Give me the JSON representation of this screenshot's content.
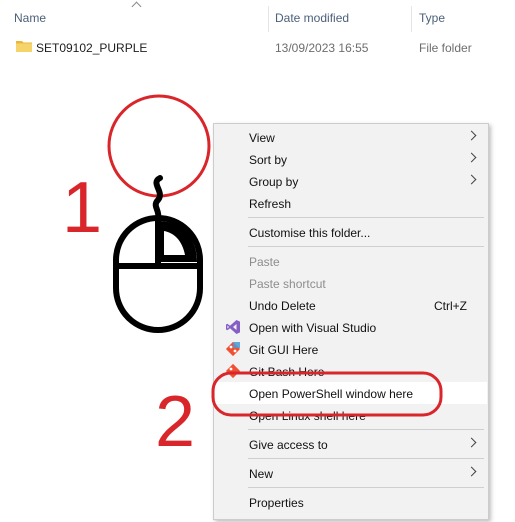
{
  "columns": {
    "name": "Name",
    "date": "Date modified",
    "type": "Type"
  },
  "files": [
    {
      "name": "SET09102_PURPLE",
      "date": "13/09/2023 16:55",
      "type": "File folder"
    }
  ],
  "context_menu": {
    "items": [
      {
        "label": "View",
        "submenu": true
      },
      {
        "label": "Sort by",
        "submenu": true
      },
      {
        "label": "Group by",
        "submenu": true
      },
      {
        "label": "Refresh"
      },
      {
        "label": "Customise this folder..."
      },
      {
        "label": "Paste",
        "disabled": true
      },
      {
        "label": "Paste shortcut",
        "disabled": true
      },
      {
        "label": "Undo Delete",
        "shortcut": "Ctrl+Z"
      },
      {
        "label": "Open with Visual Studio",
        "icon": "visual-studio-icon"
      },
      {
        "label": "Git GUI Here",
        "icon": "git-icon"
      },
      {
        "label": "Git Bash Here",
        "icon": "git-icon"
      },
      {
        "label": "Open PowerShell window here"
      },
      {
        "label": "Open Linux shell here"
      },
      {
        "label": "Give access to",
        "submenu": true
      },
      {
        "label": "New",
        "submenu": true
      },
      {
        "label": "Properties"
      }
    ]
  },
  "annotations": {
    "step1": "1",
    "step2": "2",
    "color": "#d9262b"
  }
}
